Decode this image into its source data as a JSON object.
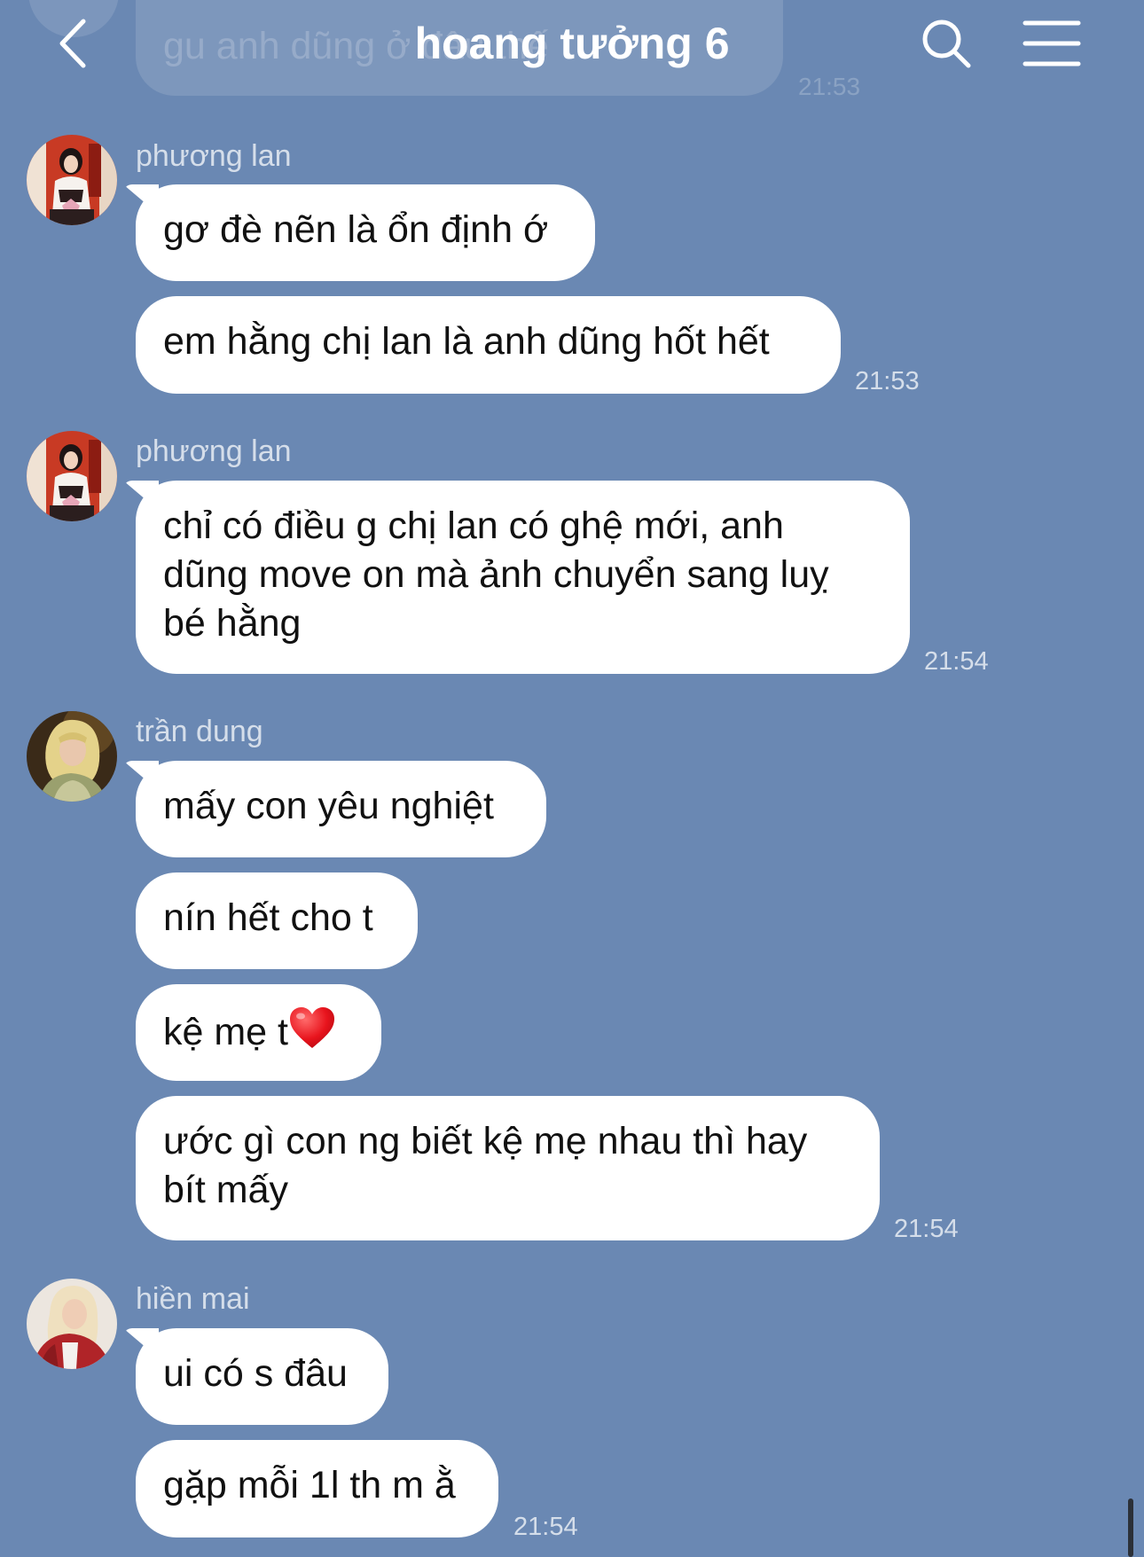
{
  "header": {
    "title": "hoang tưởng 6",
    "back_icon": "chevron-left-icon",
    "search_icon": "search-icon",
    "menu_icon": "hamburger-menu-icon"
  },
  "previous_message": {
    "text": "gu anh dũng ở đâu thế",
    "time": "21:53"
  },
  "groups": [
    {
      "sender": "phương lan",
      "messages": [
        "gơ đè nẽn là ổn định ớ",
        "em hằng chị lan là anh dũng hốt hết"
      ],
      "time": "21:53"
    },
    {
      "sender": "phương lan",
      "message_lines": [
        "chỉ có điều g chị lan có ghệ mới, anh",
        "dũng move on mà ảnh chuyển sang luỵ",
        "bé hằng"
      ],
      "time": "21:54"
    },
    {
      "sender": "trần dung",
      "messages": [
        "mấy con yêu nghiệt",
        "nín hết cho t",
        "kệ mẹ t"
      ],
      "heart_emoji": "red-heart-emoji",
      "multiline_lines": [
        "ước gì con ng biết kệ mẹ nhau thì hay",
        "bít mấy"
      ],
      "time": "21:54"
    },
    {
      "sender": "hiền mai",
      "messages": [
        "ui có s đâu",
        "gặp mỗi 1l th m ằ"
      ],
      "time": "21:54"
    }
  ],
  "colors": {
    "background": "#6a88b3",
    "bubble": "#ffffff",
    "text": "#111111"
  }
}
